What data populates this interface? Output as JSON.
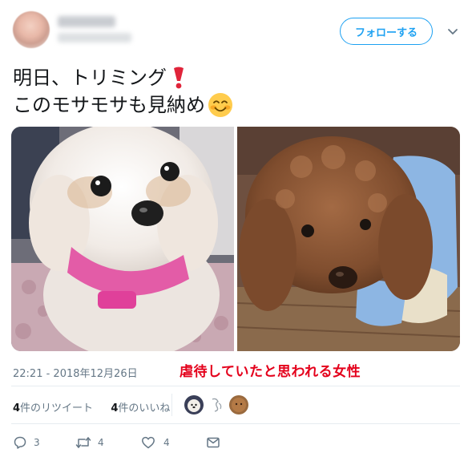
{
  "header": {
    "follow_label": "フォローする"
  },
  "tweet": {
    "line1": "明日、トリミング",
    "line2": "このモサモサも見納め",
    "emoji_1": "heavy-exclamation-mark",
    "emoji_2": "smiling-face-icon"
  },
  "meta": {
    "timestamp": "22:21 - 2018年12月26日",
    "overlay_caption": "虐待していたと思われる女性"
  },
  "stats": {
    "retweet_count": "4",
    "retweet_label": "件のリツイート",
    "like_count": "4",
    "like_label": "件のいいね"
  },
  "actions": {
    "reply_count": "3",
    "retweet_count": "4",
    "like_count": "4"
  },
  "colors": {
    "accent": "#1da1f2",
    "overlay_red": "#e4001b",
    "muted": "#657786"
  }
}
